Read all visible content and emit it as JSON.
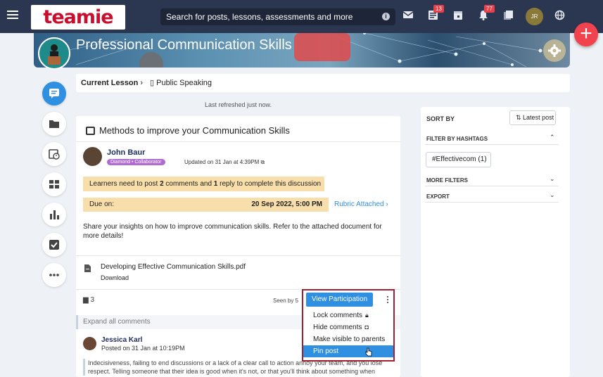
{
  "topbar": {
    "logo": "teamie",
    "search_placeholder": "Search for posts, lessons, assessments and more",
    "notif_badge_1": "13",
    "notif_badge_2": "77",
    "avatar_initials": "JR",
    "fab_label": "+"
  },
  "banner": {
    "title": "Professional Communication Skills"
  },
  "lessonbar": {
    "current_label": "Current Lesson",
    "lesson_name": "Public Speaking"
  },
  "refreshed": "Last refreshed just now.",
  "post": {
    "title": "Methods to improve your Communication Skills",
    "author": "John Baur",
    "author_badge": "Diamond • Collaborator",
    "updated": "Updated on 31 Jan at 4:39PM",
    "requirement_parts": [
      "Learners need to post ",
      "2",
      " comments and ",
      "1",
      " reply to complete this discussion"
    ],
    "due_label": "Due on:",
    "due_date": "20 Sep 2022, 5:00 PM",
    "rubric": "Rubric Attached",
    "body": "Share your insights on how to improve communication skills. Refer to the attached document for more details!",
    "attachment_name": "Developing Effective Communication Skills.pdf",
    "attachment_action": "Download",
    "comments_count": "3",
    "seen_by": "Seen by 5",
    "expand_label": "Expand all comments",
    "commenter_name": "Jessica Karl",
    "commenter_time": "Posted on 31 Jan at 10:19PM",
    "comment_text": "Indecisiveness, failing to end discussions or a lack of a clear call to action annoy your team, and you lose respect. Telling someone that their idea is good when it's not, or that you'll think about something when"
  },
  "popup": {
    "view_participation": "View Participation",
    "items": [
      "Lock comments",
      "Hide comments",
      "Make visible to parents",
      "Pin post"
    ]
  },
  "sidebar": {
    "sort_by": "SORT BY",
    "latest_post": "Latest post",
    "filter_by_hashtags": "FILTER BY HASHTAGS",
    "hashtag": "#Effectivecom (1)",
    "more_filters": "MORE FILTERS",
    "export": "EXPORT"
  },
  "colors": {
    "accent": "#2f8fe0",
    "topbar": "#2b3750",
    "alert": "#e8414b",
    "highlight": "#f8deaa"
  }
}
